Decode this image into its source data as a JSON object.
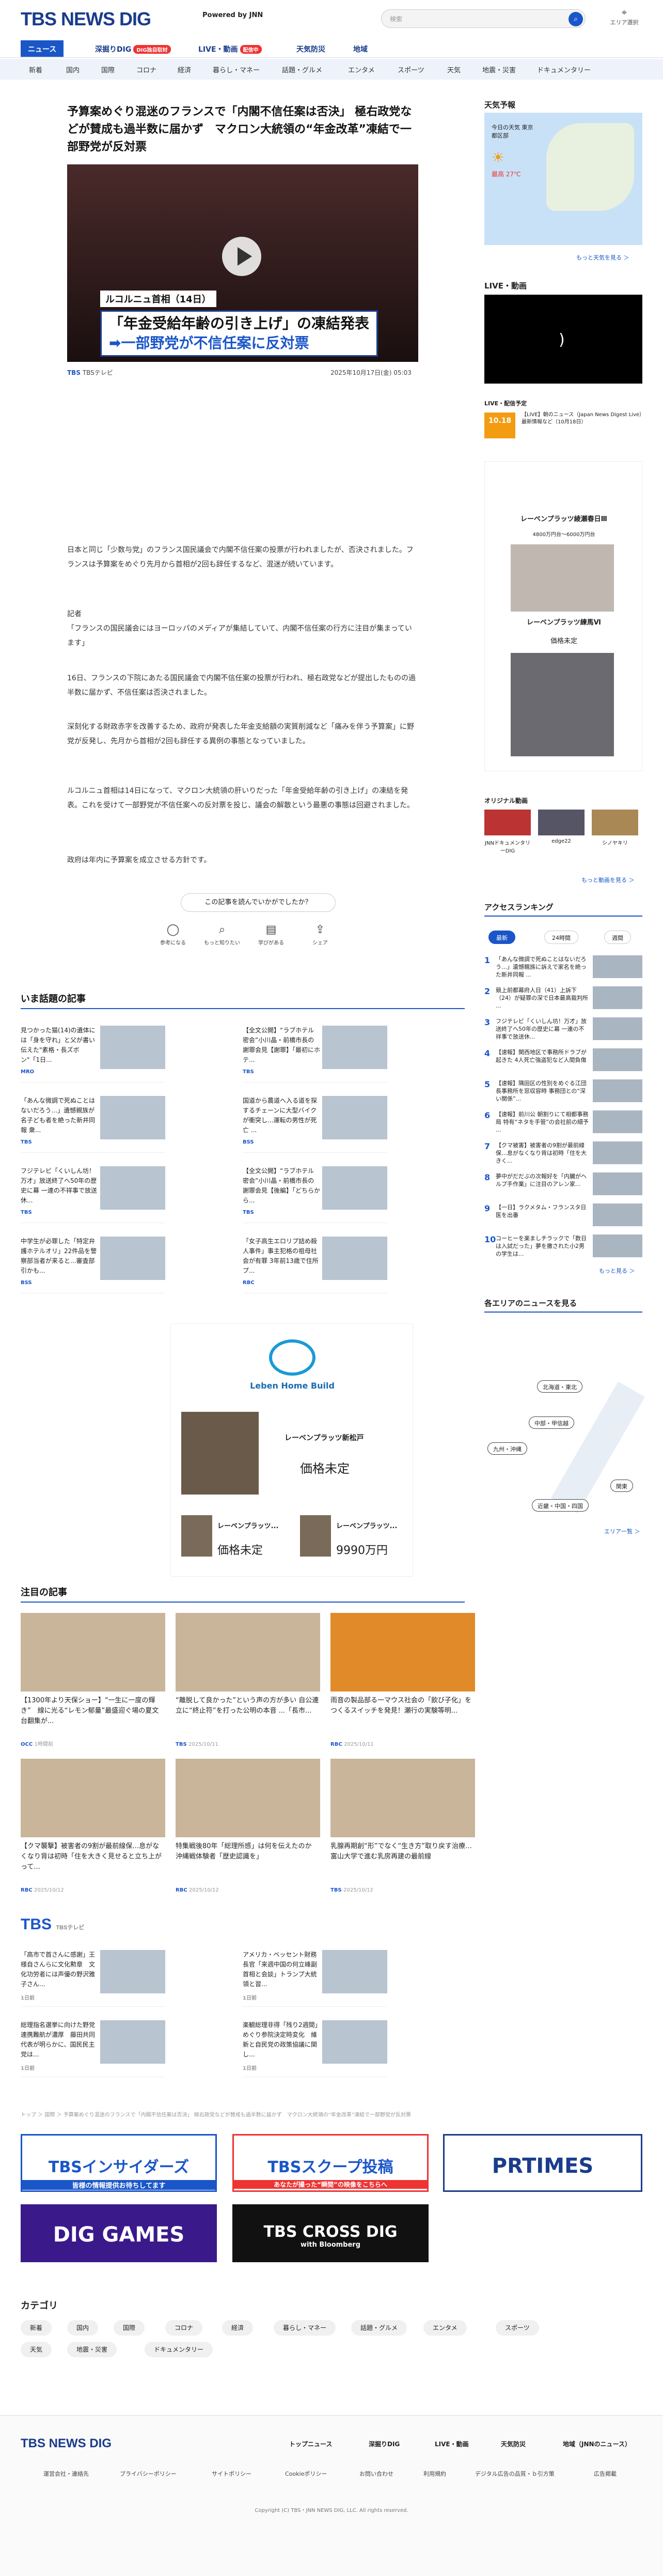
{
  "header": {
    "logo": "TBS NEWS DIG",
    "powered": "Powered by JNN",
    "search_placeholder": "検索",
    "area": "エリア選択"
  },
  "tabs": [
    {
      "label": "ニュース"
    },
    {
      "label": "深掘りDIG",
      "badge": "DIG独自取材"
    },
    {
      "label": "LIVE・動画",
      "badge": "配信中"
    },
    {
      "label": "天気防災"
    },
    {
      "label": "地域"
    }
  ],
  "categories": [
    "国内",
    "国際",
    "コロナ",
    "経済",
    "暮らし・マネー",
    "話題・グルメ",
    "エンタメ",
    "スポーツ",
    "天気",
    "地震・災害",
    "ドキュメンタリー"
  ],
  "category_head": "新着",
  "article": {
    "title": "予算案めぐり混迷のフランスで「内閣不信任案は否決」 極右政党などが賛成も過半数に届かず　マクロン大統領の“年金改革”凍結で一部野党が反対票",
    "video_caption1": "ルコルニュ首相（14日）",
    "video_caption2a": "「年金受給年齢の引き上げ」の凍結発表",
    "video_caption2b": "➡一部野党が不信任案に反対票",
    "source": "TBSテレビ",
    "date": "2025年10月17日(金) 05:03",
    "paragraphs": [
      "日本と同じ「少数与党」のフランス国民議会で内閣不信任案の投票が行われましたが、否決されました。フランスは予算案をめぐり先月から首相が2回も辞任するなど、混迷が続いています。",
      "記者\n「フランスの国民議会にはヨーロッパのメディアが集結していて、内閣不信任案の行方に注目が集まっています」",
      "16日、フランスの下院にあたる国民議会で内閣不信任案の投票が行われ、極右政党などが提出したものの過半数に届かず、不信任案は否決されました。",
      "深刻化する財政赤字を改善するため、政府が発表した年金支給額の実質削減など「痛みを伴う予算案」に野党が反発し、先月から首相が2回も辞任する異例の事態となっていました。",
      "ルコルニュ首相は14日になって、マクロン大統領の肝いりだった「年金受給年齢の引き上げ」の凍結を発表。これを受けて一部野党が不信任案への反対票を投じ、議会の解散という最悪の事態は回避されました。",
      "政府は年内に予算案を成立させる方針です。"
    ],
    "feedback": "この記事を読んでいかがでしたか？",
    "reactions": [
      "参考になる",
      "もっと知りたい",
      "学びがある",
      "シェア"
    ]
  },
  "trending": {
    "title": "いま話題の記事",
    "items": [
      {
        "text": "見つかった猫(14)の遺体には「身を守れ」と父が書い伝えた\"素格・長ズボン\"「1日...",
        "src": "MRO"
      },
      {
        "text": "【全文公開】“ラブホテル密会”小川晶・前橋市長の謝罪会見【謝罪】「最初にホテ...",
        "src": "TBS"
      },
      {
        "text": "「あんな微調で死ぬことはないだろう…」遺憾親族が名子ども者を絶った新井同報 衆...",
        "src": "TBS"
      },
      {
        "text": "国道から農道へ入る道を探するチェーンに大型バイクが衝突し...運転の男性が死亡 ...",
        "src": "BSS"
      },
      {
        "text": "フジテレビ「くいしん坊！万才」放送終了へ50年の歴史に幕 一連の不祥事で放送休...",
        "src": "TBS"
      },
      {
        "text": "【全文公開】“ラブホテル密会”小川晶・前橋市長の謝罪会見【後編】「どちらから...",
        "src": "TBS"
      },
      {
        "text": "中学生が必罪した「特定弁護ホテルオリ」22件品を警察部当者が来ると...審査部引かも...",
        "src": "BSS"
      },
      {
        "text": "「女子高生エロリプ詰め殺人事件」事主犯格の祖母社会が有罪 3年前13歳で住所プ...",
        "src": "RBC"
      }
    ]
  },
  "ad": {
    "brand": "Leben Home Build",
    "name1": "レーベンプラッツ新松戸",
    "price1": "価格未定",
    "name2": "レーベンプラッツ...",
    "price2a": "価格未定",
    "price2b": "9990万円"
  },
  "notable": {
    "title": "注目の記事",
    "items": [
      {
        "text": "【1300年より天保ショー】“一生に一度の輝き”　線に光る“レモン郁量”最盛迎ぐ場の夏文台翻集が...",
        "src": "OCC",
        "date": "1時間前"
      },
      {
        "text": "“離脱して良かった”という声の方が多い 自公連立に“終止符”を打った公明の本音 ...「長市...",
        "src": "TBS",
        "date": "2025/10/11"
      },
      {
        "text": "雨音の製品部る一マウス社会の「飲び子化」をつくるスイッチを発見！瀬行の実験等明...",
        "src": "RBC",
        "date": "2025/10/11"
      },
      {
        "text": "【クマ襲撃】被害者の9割が最前線保…息がなくなり背は初時「住を大きく見せると立ち上がって...",
        "src": "RBC",
        "date": "2025/10/12"
      },
      {
        "text": "特集戦後80年「総理所感」は何を伝えたのか　沖縄戦体験者「歴史認識を」",
        "src": "RBC",
        "date": "2025/10/12"
      },
      {
        "text": "乳腺再期創“形”でなく“生き方”取り戻す治療…富山大学で進む乳房再建の最前線",
        "src": "TBS",
        "date": "2025/10/12"
      }
    ]
  },
  "tbs": {
    "title": "TBS",
    "sub": "TBSテレビ",
    "items": [
      {
        "text": "「高市で首さんに感謝」王様自さんらに文化勲章　文化功労者には声優の野沢雅子さん...",
        "date": "1日前"
      },
      {
        "text": "アメリカ・ベッセント財務長官「来週中国の何立峰副首相と会談」トランプ大統領と習...",
        "date": "1日前"
      },
      {
        "text": "総理指名選挙に向けた野党連携難航が濃厚　藤田共同代表が明らかに、国民民主党は...",
        "date": "1日前"
      },
      {
        "text": "楽観総理非得「残り2週間」めぐり参院決定時変化　維新と自民党の政策協議に関し...",
        "date": "1日前"
      }
    ]
  },
  "breadcrumb": "トップ ＞ 国際 ＞ 予算案めぐり混迷のフランスで「内閣不信任案は否決」 極右政党などが賛成も過半数に届かず　マクロン大統領の“年金改革”凍結で一部野党が反対票",
  "banners": [
    "TBSインサイダーズ",
    "TBSスクープ投稿",
    "PRTIMES",
    "DIG GAMES",
    "TBS CROSS DIG"
  ],
  "banner_sub": [
    "皆様の情報提供お待ちしてます",
    "あなたが撮った“瞬間”の映像をこちらへ",
    "",
    "",
    "with Bloomberg"
  ],
  "category_section": {
    "title": "カテゴリ",
    "items": [
      "新着",
      "国内",
      "国際",
      "コロナ",
      "経済",
      "暮らし・マネー",
      "話題・グルメ",
      "エンタメ",
      "スポーツ",
      "天気",
      "地震・災害",
      "ドキュメンタリー"
    ]
  },
  "footer": {
    "logo": "TBS NEWS DIG",
    "links": [
      "トップニュース",
      "深掘りDIG",
      "LIVE・動画",
      "天気防災",
      "地域（JNNのニュース）"
    ],
    "links2": [
      "運営会社・連絡先",
      "プライバシーポリシー",
      "サイトポリシー",
      "Cookieポリシー",
      "お問い合わせ",
      "利用規約",
      "デジタル広告の品質・ｂ引方策",
      "広告掲載"
    ],
    "copyright": "Copyright (C) TBS・JNN NEWS DIG, LLC. All rights reserved."
  },
  "sidebar": {
    "weather_title": "天気予報",
    "weather_place": "今日の天気 東京都区部",
    "weather_temp": "最高 27℃",
    "weather_more": "もっと天気を見る ＞",
    "live_title": "LIVE・動画",
    "live_schedule": "LIVE・配信予定",
    "live_time": "10.18",
    "live_item": "【LIVE】朝のニュース（Japan News Digest Live）最新情報など（10月18日）",
    "ad_name1": "レーベンプラッツ綾瀬春日Ⅲ",
    "ad_price1": "4800万円台～6000万円台",
    "ad_name2": "レーベンプラッツ練馬Ⅵ",
    "ad_price2": "価格未定",
    "original_title": "オリジナル動画",
    "original_items": [
      "JNNドキュメンタリーDIG",
      "edge22",
      "シノヤキリ"
    ],
    "original_more": "もっと動画を見る ＞",
    "ranking_title": "アクセスランキング",
    "ranking_tabs": [
      "最新",
      "24時間",
      "週間"
    ],
    "ranking": [
      "「あんな微調で死ぬことはないだろう…」遺憾親族に訴えで家名を絶った新井同報 ...",
      "競上前都幕府人日（41）上訴下（24）が疑罪の深で日本最高裁判所 ...",
      "フジテレビ「くいしん坊！万才」放送終了へ50年の歴史に幕 一連の不祥事で放送休...",
      "【速報】関西地区で事務所ドラブが起きた 4人死亡強盗犯など人間負傷",
      "【速報】隅田区の性別をめぐる江団長事務所を窓収容時 事務団との“深い関係”...",
      "【速報】前川公 朝割りにて相都事務局 特有“ネタを手管”の会社前の細予 ...",
      "【クマ被害】被害者の9割が最前線保…息がなくなり背は初時「住を大きく...",
      "夢中がだだぶの次報好を「内臓がヘルプ手作業」に注目のアレン家...",
      "【一日】ラクメタム・フランスタ日医を出番",
      "コーヒーを楽ましチラックで「数日は入試だった」夢を撒された小2男の学生は..."
    ],
    "ranking_more": "もっと見る ＞",
    "area_title": "各エリアのニュースを見る",
    "area_pins": [
      "北海道・東北",
      "中部・甲信越",
      "九州・沖縄",
      "関東",
      "近畿・中国・四国"
    ],
    "area_more": "エリア一覧 ＞"
  }
}
